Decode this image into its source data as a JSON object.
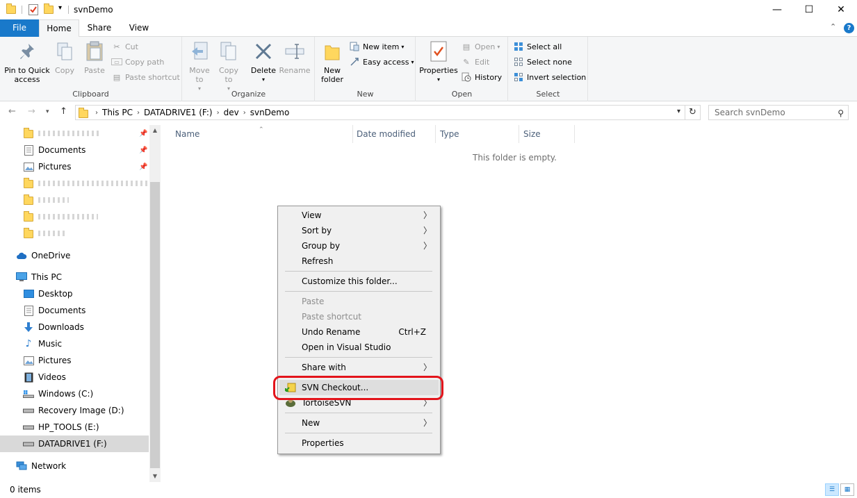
{
  "window": {
    "title": "svnDemo",
    "minimize": "—",
    "maximize": "☐",
    "close": "✕"
  },
  "ribbon_tabs": {
    "file": "File",
    "home": "Home",
    "share": "Share",
    "view": "View"
  },
  "clipboard": {
    "label": "Clipboard",
    "pin": "Pin to Quick access",
    "copy": "Copy",
    "paste": "Paste",
    "cut": "Cut",
    "copy_path": "Copy path",
    "paste_shortcut": "Paste shortcut"
  },
  "organize": {
    "label": "Organize",
    "move_to": "Move to",
    "copy_to": "Copy to",
    "delete": "Delete",
    "rename": "Rename"
  },
  "new_group": {
    "label": "New",
    "new_folder": "New folder",
    "new_item": "New item",
    "easy_access": "Easy access"
  },
  "open_group": {
    "label": "Open",
    "properties": "Properties",
    "open": "Open",
    "edit": "Edit",
    "history": "History"
  },
  "select_group": {
    "label": "Select",
    "select_all": "Select all",
    "select_none": "Select none",
    "invert_selection": "Invert selection"
  },
  "address": {
    "crumbs": [
      "This PC",
      "DATADRIVE1 (F:)",
      "dev",
      "svnDemo"
    ],
    "search_placeholder": "Search svnDemo"
  },
  "nav": {
    "quick": [
      "Documents",
      "Pictures"
    ],
    "onedrive": "OneDrive",
    "this_pc": "This PC",
    "pc_items": [
      "Desktop",
      "Documents",
      "Downloads",
      "Music",
      "Pictures",
      "Videos",
      "Windows (C:)",
      "Recovery Image (D:)",
      "HP_TOOLS (E:)",
      "DATADRIVE1 (F:)"
    ],
    "network": "Network"
  },
  "columns": {
    "name": "Name",
    "date_modified": "Date modified",
    "type": "Type",
    "size": "Size"
  },
  "empty_message": "This folder is empty.",
  "status": {
    "count": "0 items"
  },
  "context_menu": {
    "view": "View",
    "sort_by": "Sort by",
    "group_by": "Group by",
    "refresh": "Refresh",
    "customize": "Customize this folder...",
    "paste": "Paste",
    "paste_shortcut": "Paste shortcut",
    "undo_rename": "Undo Rename",
    "undo_accel": "Ctrl+Z",
    "open_vs": "Open in Visual Studio",
    "share_with": "Share with",
    "svn_checkout": "SVN Checkout...",
    "tortoise": "TortoiseSVN",
    "new": "New",
    "properties": "Properties"
  },
  "colors": {
    "accent": "#1979ca",
    "highlight_ring": "#e3141b",
    "folder": "#ffd75e"
  }
}
